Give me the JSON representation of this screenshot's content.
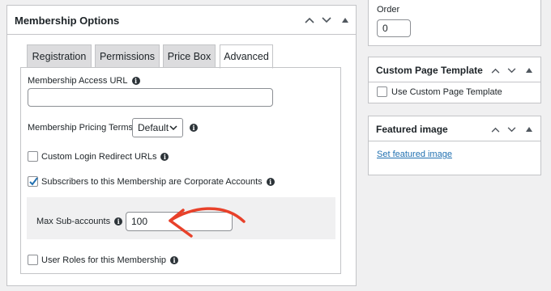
{
  "main_box": {
    "title": "Membership Options",
    "tabs": [
      "Registration",
      "Permissions",
      "Price Box",
      "Advanced"
    ],
    "active_tab": "Advanced",
    "access_url": {
      "label": "Membership Access URL",
      "value": ""
    },
    "pricing_terms": {
      "label": "Membership Pricing Terms:",
      "selected": "Default"
    },
    "custom_login_redirect": {
      "label": "Custom Login Redirect URLs",
      "checked": false
    },
    "corporate_accounts": {
      "label": "Subscribers to this Membership are Corporate Accounts",
      "checked": true
    },
    "max_sub_accounts": {
      "label": "Max Sub-accounts",
      "value": "100"
    },
    "user_roles": {
      "label": "User Roles for this Membership",
      "checked": false
    }
  },
  "order_box": {
    "label": "Order",
    "value": "0"
  },
  "template_box": {
    "title": "Custom Page Template",
    "checkbox_label": "Use Custom Page Template",
    "checked": false
  },
  "featured_box": {
    "title": "Featured image",
    "link": "Set featured image"
  },
  "icons": {
    "up": "chevron-up-icon",
    "down": "chevron-down-icon",
    "toggle": "triangle-toggle-icon",
    "info": "info-icon",
    "annotation": "red-arrow-annotation"
  },
  "colors": {
    "accent": "#2271b1",
    "annotation": "#e8412a",
    "check": "#2271b1"
  }
}
